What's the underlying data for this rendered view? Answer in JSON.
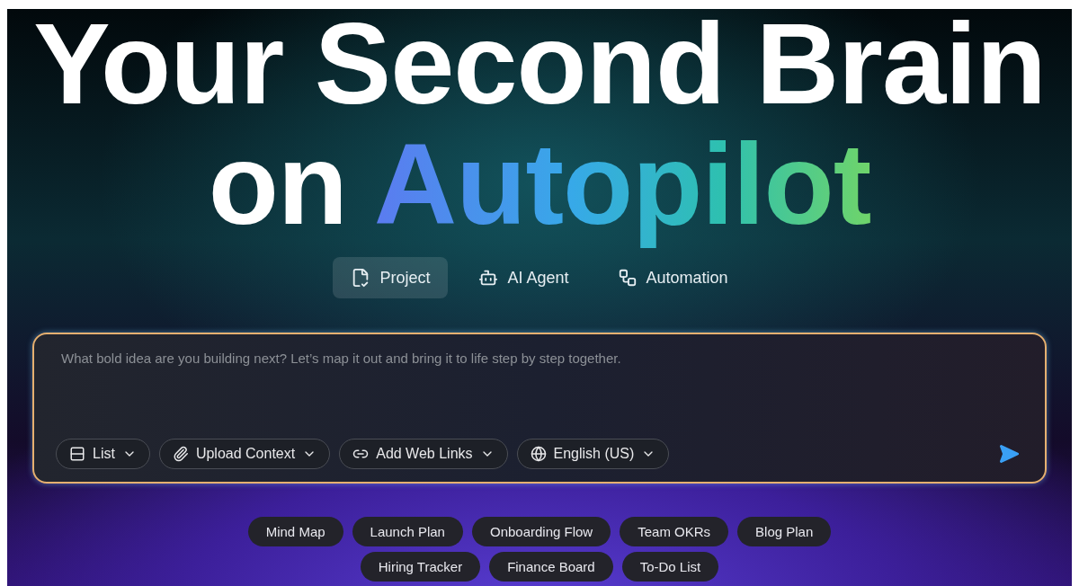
{
  "headline": {
    "line1": "Your Second Brain",
    "line2_lead": "on",
    "line2_highlight": "Autopilot"
  },
  "modes": [
    {
      "label": "Project",
      "selected": true
    },
    {
      "label": "AI Agent",
      "selected": false
    },
    {
      "label": "Automation",
      "selected": false
    }
  ],
  "prompt": {
    "placeholder": "What bold idea are you building next? Let’s map it out and bring it to life step by step together.",
    "options": [
      {
        "label": "List"
      },
      {
        "label": "Upload Context"
      },
      {
        "label": "Add Web Links"
      },
      {
        "label": "English (US)"
      }
    ]
  },
  "suggestions": [
    [
      "Mind Map",
      "Launch Plan",
      "Onboarding Flow",
      "Team OKRs",
      "Blog Plan"
    ],
    [
      "Hiring Tracker",
      "Finance Board",
      "To-Do List"
    ]
  ]
}
